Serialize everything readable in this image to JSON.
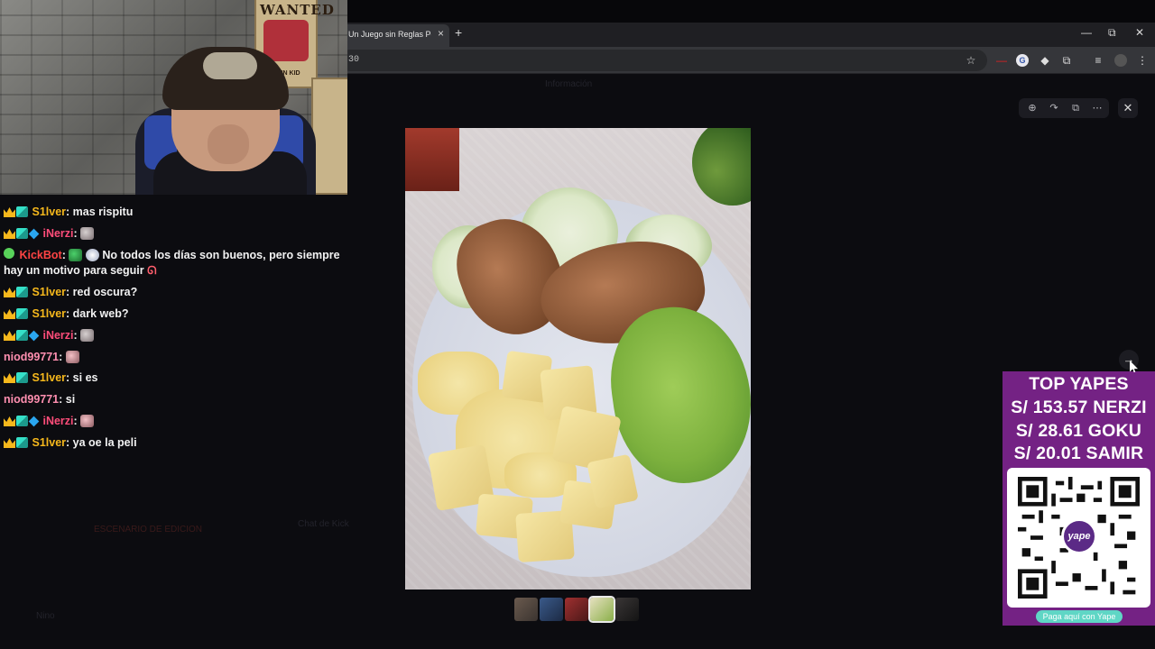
{
  "browser": {
    "tab_title": "Un Juego sin Reglas Peli",
    "new_tab_label": "+",
    "tab_close": "×",
    "window_min": "—",
    "window_max": "⧉",
    "window_close": "✕",
    "address_fragment": "30"
  },
  "under": {
    "left_label": "Información",
    "chat_label": "Chat de Kick",
    "user_label": "Nino",
    "mod_button": "ESCENARIO DE EDICION"
  },
  "chat": {
    "messages": [
      {
        "user": "S1lver",
        "sep": ":",
        "text": "mas rispitu"
      },
      {
        "user": "iNerzi",
        "sep": ":",
        "text": ""
      },
      {
        "user": "KickBot",
        "sep": ":",
        "text": "No todos los días son buenos, pero siempre hay un motivo para seguir"
      },
      {
        "user": "S1lver",
        "sep": ":",
        "text": "red oscura?"
      },
      {
        "user": "S1lver",
        "sep": ":",
        "text": "dark web?"
      },
      {
        "user": "iNerzi",
        "sep": ":",
        "text": ""
      },
      {
        "user": "niod99771",
        "sep": ":",
        "text": ""
      },
      {
        "user": "S1lver",
        "sep": ":",
        "text": "si es"
      },
      {
        "user": "niod99771",
        "sep": ":",
        "text": "si"
      },
      {
        "user": "iNerzi",
        "sep": ":",
        "text": ""
      },
      {
        "user": "S1lver",
        "sep": ":",
        "text": "ya oe la peli"
      }
    ]
  },
  "webcam": {
    "poster_word": "WANTED",
    "poster_small": "CAPTAIN KID"
  },
  "viewer": {
    "close": "✕",
    "next": "→",
    "tools": [
      "zoom-icon",
      "rotate-icon",
      "open-external-icon",
      "more-icon"
    ]
  },
  "yape": {
    "title": "TOP YAPES",
    "lines": [
      "S/ 153.57 NERZI",
      "S/ 28.61 GOKU",
      "S/ 20.01 SAMIR"
    ],
    "logo_text": "yape",
    "pill_text": "Paga aquí con Yape",
    "bg_color": "#742284"
  }
}
